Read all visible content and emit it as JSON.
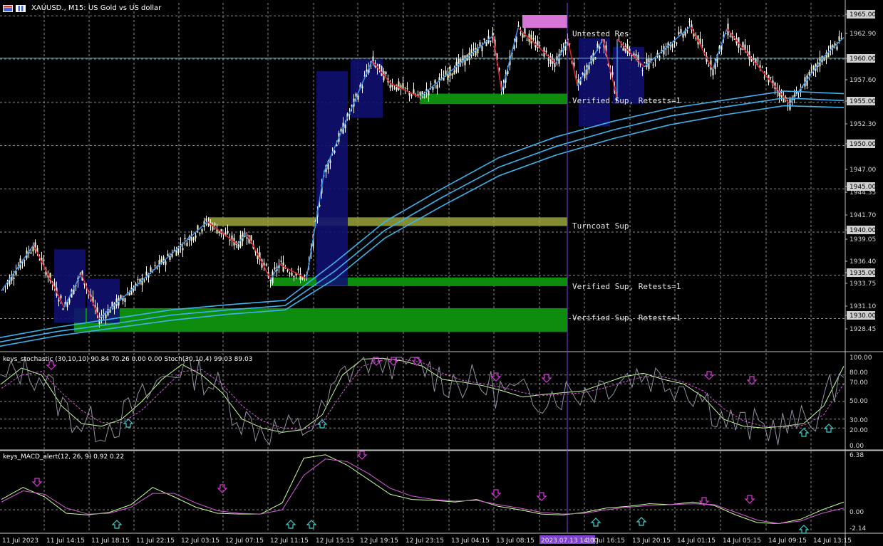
{
  "header": {
    "symbol": "XAUUSD.",
    "timeframe": "M15",
    "description": "US Gold vs US dollar",
    "icons": [
      "chart-grid-icon",
      "bar-chart-icon"
    ]
  },
  "indicators": {
    "stochastic_label": "keys_stochastic (30,10,10) 90.84 70.26 0.00 0.00 Stoch(30,10,4) 99.03 89.03",
    "macd_label": "keys_MACD_alert(12, 26, 9) 0.92 0.22"
  },
  "colors": {
    "background": "#000000",
    "grid": "#8c8c8c",
    "bull_candle": "#ffffc0",
    "bear_candle": "#ffffff",
    "zigzag_up": "#3a8ee6",
    "zigzag_down": "#e0202a",
    "ma_bands": "#3fb2ee",
    "support_zone": "#0e8c0e",
    "resistance_zone": "#d876d8",
    "turncoat_zone": "#9aa43c",
    "range_box": "#101070",
    "price_line": "#48c8d8",
    "vertical_marker": "#8040d0",
    "arrow_down": "#d838d8",
    "arrow_up": "#40d0d0"
  },
  "chart_data": {
    "type": "line",
    "instrument": "XAUUSD.",
    "timeframe": "M15",
    "price_axis": {
      "ticks": [
        "1965.00",
        "1962.90",
        "1960.00",
        "1957.60",
        "1955.00",
        "1952.30",
        "1950.00",
        "1947.00",
        "1945.00",
        "1944.35",
        "1941.70",
        "1940.00",
        "1939.05",
        "1936.40",
        "1935.00",
        "1933.75",
        "1931.10",
        "1930.00",
        "1928.45"
      ],
      "highlighted": [
        "1965.00",
        "1960.00",
        "1955.00",
        "1950.00",
        "1945.00",
        "1940.00",
        "1935.00",
        "1930.00"
      ],
      "current_price": "1960.00",
      "range": [
        1926.5,
        1966.5
      ]
    },
    "time_axis": {
      "ticks": [
        "11 Jul 2023",
        "11 Jul 14:15",
        "11 Jul 18:15",
        "11 Jul 22:15",
        "12 Jul 03:15",
        "12 Jul 07:15",
        "12 Jul 11:15",
        "12 Jul 15:15",
        "12 Jul 19:15",
        "12 Jul 23:15",
        "13 Jul 04:15",
        "13 Jul 08:15",
        "2023.07.13 14:00",
        "13 Jul 16:15",
        "13 Jul 20:15",
        "14 Jul 01:15",
        "14 Jul 05:15",
        "14 Jul 09:15",
        "14 Jul 13:15"
      ],
      "cursor_label": "2023.07.13 14:00"
    },
    "zones": [
      {
        "label": "Untested Res",
        "low": 1963.6,
        "high": 1965.1
      },
      {
        "label": "Verified Sup, Retests=1",
        "low": 1954.8,
        "high": 1956.0
      },
      {
        "label": "Turncoat Sup",
        "low": 1940.7,
        "high": 1941.7
      },
      {
        "label": "Verified Sup, Retests=1",
        "low": 1933.75,
        "high": 1934.75
      },
      {
        "label": "Verified Sup, Retests=1",
        "low": 1928.45,
        "high": 1931.2
      }
    ],
    "zigzag": [
      1933.2,
      1938.5,
      1931.3,
      1935.2,
      1930.0,
      1932.6,
      1941.2,
      1938.6,
      1939.9,
      1934.5,
      1936.3,
      1934.6,
      1947.0,
      1959.8,
      1957.2,
      1955.6,
      1962.7,
      1956.2,
      1963.6,
      1959.5,
      1962.2,
      1956.9,
      1962.3,
      1955.4,
      1962.3,
      1959.1,
      1963.8,
      1958.8,
      1963.5,
      1954.8,
      1960.2,
      1962.5
    ],
    "ma_upper": [
      1927.8,
      1929.0,
      1930.0,
      1931.0,
      1931.6,
      1932.1,
      1936.5,
      1941.2,
      1945.0,
      1948.6,
      1951.0,
      1952.8,
      1954.3,
      1955.3,
      1956.3,
      1956.0
    ],
    "ma_middle": [
      1927.3,
      1928.5,
      1929.4,
      1930.4,
      1931.0,
      1931.5,
      1935.5,
      1940.2,
      1944.0,
      1947.5,
      1949.9,
      1951.8,
      1953.4,
      1954.5,
      1955.5,
      1955.2
    ],
    "ma_lower": [
      1926.8,
      1928.0,
      1928.9,
      1929.8,
      1930.5,
      1931.0,
      1934.6,
      1939.3,
      1943.0,
      1946.5,
      1948.9,
      1950.8,
      1952.4,
      1953.6,
      1954.6,
      1954.4
    ],
    "stochastic": {
      "axis_ticks": [
        "100.00",
        "80.00",
        "70.00",
        "50.00",
        "30.00",
        "20.00",
        "0.00"
      ],
      "main": [
        70,
        88,
        80,
        45,
        25,
        22,
        30,
        50,
        75,
        92,
        80,
        60,
        30,
        20,
        15,
        18,
        35,
        80,
        98,
        99,
        96,
        90,
        75,
        72,
        68,
        62,
        55,
        58,
        60,
        62,
        70,
        78,
        82,
        75,
        70,
        55,
        30,
        22,
        20,
        22,
        25,
        45,
        90
      ],
      "signal": [
        65,
        80,
        84,
        60,
        40,
        26,
        26,
        40,
        62,
        84,
        86,
        70,
        45,
        28,
        20,
        18,
        26,
        60,
        90,
        97,
        98,
        94,
        82,
        74,
        70,
        66,
        60,
        57,
        58,
        60,
        65,
        72,
        78,
        78,
        72,
        62,
        42,
        28,
        22,
        21,
        23,
        35,
        70
      ]
    },
    "macd": {
      "axis_ticks": [
        "6.38",
        "0.00",
        "-2.14"
      ],
      "main": [
        1.2,
        2.6,
        1.5,
        -0.4,
        -0.6,
        -0.3,
        0.6,
        2.6,
        1.5,
        0.3,
        -0.4,
        -0.5,
        -0.5,
        0.8,
        6.0,
        6.4,
        5.2,
        3.5,
        1.8,
        1.2,
        1.1,
        0.9,
        1.2,
        0.4,
        0.0,
        -0.5,
        -0.6,
        -0.3,
        0.2,
        0.4,
        0.7,
        0.6,
        0.9,
        0.5,
        -0.6,
        -1.5,
        -1.6,
        -1.1,
        0.0,
        0.9
      ],
      "signal": [
        0.9,
        2.2,
        1.8,
        0.2,
        -0.5,
        -0.4,
        0.3,
        1.9,
        1.9,
        0.8,
        -0.1,
        -0.4,
        -0.5,
        0.0,
        4.0,
        5.9,
        5.6,
        4.2,
        2.5,
        1.6,
        1.2,
        1.0,
        1.1,
        0.6,
        0.2,
        -0.3,
        -0.5,
        -0.4,
        0.0,
        0.3,
        0.5,
        0.6,
        0.7,
        0.6,
        -0.3,
        -1.2,
        -1.6,
        -1.3,
        -0.4,
        0.2
      ]
    }
  }
}
